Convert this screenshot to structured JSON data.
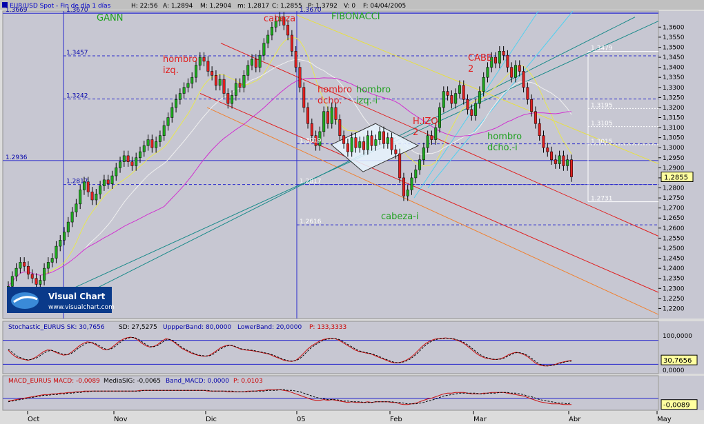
{
  "header": {
    "title": "EUR/USD Spot - Fin de día 1 días",
    "quote_h": "H: 22:56",
    "quote_a": "A: 1,2894",
    "quote_m": "M: 1,2904",
    "quote_m2": "m: 1,2817",
    "quote_c": "C: 1,2855",
    "quote_p": "P: 1,3792",
    "quote_v": "V: 0",
    "quote_f": "F: 04/04/2005"
  },
  "logo": {
    "name": "Visual Chart",
    "url": "www.visualchart.com"
  },
  "colors": {
    "background": "#c7c7d2",
    "up_candle": "#1fa81f",
    "down_candle": "#e02020",
    "fib_line": "#2a2acc",
    "yellow_ma": "#e8e850",
    "white_ma": "#f0f0f0",
    "magenta_ma": "#d030d0",
    "red_channel": "#e02020",
    "orange_channel": "#f08030",
    "teal_channel": "#1a8a8a",
    "cyan_line": "#50d0f0"
  },
  "chart_data": [
    {
      "type": "candlestick",
      "title": "EUR/USD Spot",
      "ylim": [
        1.215,
        1.368
      ],
      "yticks": [
        "1,3600",
        "1,3550",
        "1,3500",
        "1,3450",
        "1,3400",
        "1,3350",
        "1,3300",
        "1,3250",
        "1,3200",
        "1,3150",
        "1,3100",
        "1,3050",
        "1,3000",
        "1,2950",
        "1,2900",
        "1,2850",
        "1,2800",
        "1,2750",
        "1,2700",
        "1,2650",
        "1,2600",
        "1,2550",
        "1,2500",
        "1,2450",
        "1,2400",
        "1,2350",
        "1,2300",
        "1,2250",
        "1,2200"
      ],
      "ytick_values": [
        1.36,
        1.355,
        1.35,
        1.345,
        1.34,
        1.335,
        1.33,
        1.325,
        1.32,
        1.315,
        1.31,
        1.305,
        1.3,
        1.295,
        1.29,
        1.285,
        1.28,
        1.275,
        1.27,
        1.265,
        1.26,
        1.255,
        1.25,
        1.245,
        1.24,
        1.235,
        1.23,
        1.225,
        1.22
      ],
      "last_price": "1,2855",
      "last_value": 1.2855,
      "xticks": [
        "Oct",
        "Nov",
        "Dic",
        "05",
        "Feb",
        "Mar",
        "Abr",
        "May"
      ],
      "levels_left": [
        {
          "value": 1.3669,
          "label": "1.3669"
        },
        {
          "value": 1.2936,
          "label": "1.2936"
        }
      ],
      "levels_gann": [
        {
          "value": 1.367,
          "label": "1.3670"
        },
        {
          "value": 1.3457,
          "label": "1.3457"
        },
        {
          "value": 1.3242,
          "label": "1.3242"
        },
        {
          "value": 1.2817,
          "label": "1.2817"
        }
      ],
      "levels_fib": [
        {
          "value": 1.367,
          "label": "1.3670"
        },
        {
          "value": 1.3019,
          "label": "1.3019"
        },
        {
          "value": 1.2817,
          "label": "1.2817"
        },
        {
          "value": 1.2616,
          "label": "1.2616"
        }
      ],
      "levels_right": [
        {
          "value": 1.3479,
          "label": "1.3479"
        },
        {
          "value": 1.3195,
          "label": "1.3195"
        },
        {
          "value": 1.3105,
          "label": "1.3105"
        },
        {
          "value": 1.3015,
          "label": "1.3015"
        },
        {
          "value": 1.2731,
          "label": "1.2731"
        }
      ],
      "annotations": [
        {
          "text": "GANN",
          "color": "green"
        },
        {
          "text": "FIBONACCI",
          "color": "green"
        },
        {
          "text": "cabeza",
          "color": "red"
        },
        {
          "text": "hombro",
          "color": "red"
        },
        {
          "text": "izq.",
          "color": "red"
        },
        {
          "text": "hombro",
          "color": "red"
        },
        {
          "text": "dcho.",
          "color": "red"
        },
        {
          "text": "hombro",
          "color": "green"
        },
        {
          "text": "izq.-i",
          "color": "green"
        },
        {
          "text": "H.IZQ.",
          "color": "red"
        },
        {
          "text": "2",
          "color": "red"
        },
        {
          "text": "CABE",
          "color": "red"
        },
        {
          "text": "2",
          "color": "red"
        },
        {
          "text": "hombro",
          "color": "green"
        },
        {
          "text": "dcho.-i",
          "color": "green"
        },
        {
          "text": "cabeza-i",
          "color": "green"
        }
      ],
      "close_values": [
        1.231,
        1.236,
        1.24,
        1.243,
        1.241,
        1.237,
        1.235,
        1.232,
        1.234,
        1.24,
        1.243,
        1.245,
        1.251,
        1.254,
        1.258,
        1.263,
        1.268,
        1.272,
        1.279,
        1.283,
        1.278,
        1.274,
        1.277,
        1.281,
        1.284,
        1.282,
        1.286,
        1.29,
        1.293,
        1.296,
        1.293,
        1.291,
        1.295,
        1.298,
        1.301,
        1.304,
        1.3,
        1.303,
        1.306,
        1.311,
        1.315,
        1.32,
        1.324,
        1.327,
        1.33,
        1.332,
        1.335,
        1.341,
        1.345,
        1.343,
        1.338,
        1.336,
        1.331,
        1.334,
        1.327,
        1.322,
        1.326,
        1.332,
        1.33,
        1.336,
        1.341,
        1.344,
        1.34,
        1.346,
        1.352,
        1.356,
        1.36,
        1.363,
        1.365,
        1.361,
        1.356,
        1.348,
        1.34,
        1.33,
        1.32,
        1.312,
        1.306,
        1.301,
        1.308,
        1.318,
        1.312,
        1.32,
        1.314,
        1.306,
        1.302,
        1.298,
        1.305,
        1.3,
        1.303,
        1.299,
        1.306,
        1.301,
        1.304,
        1.308,
        1.302,
        1.305,
        1.299,
        1.297,
        1.285,
        1.276,
        1.279,
        1.285,
        1.289,
        1.294,
        1.3,
        1.306,
        1.304,
        1.31,
        1.32,
        1.328,
        1.326,
        1.322,
        1.327,
        1.331,
        1.324,
        1.319,
        1.316,
        1.322,
        1.328,
        1.335,
        1.34,
        1.345,
        1.342,
        1.348,
        1.346,
        1.34,
        1.335,
        1.341,
        1.338,
        1.33,
        1.324,
        1.318,
        1.312,
        1.306,
        1.3,
        1.298,
        1.294,
        1.292,
        1.296,
        1.291,
        1.294,
        1.2855
      ]
    },
    {
      "type": "line",
      "title": "Stochastic_EURUS",
      "labels": {
        "sk": "Stochastic_EURUS SK: 30,7656",
        "sd": "SD: 27,5275",
        "upper": "UppperBand: 80,0000",
        "lower": "LowerBand: 20,0000",
        "p": "P: 133,3333"
      },
      "ylim": [
        0,
        100
      ],
      "yticks": [
        "100,0000",
        "0,0000"
      ],
      "bands": [
        80,
        20
      ],
      "last_value": "30,7656",
      "series": [
        {
          "name": "SK",
          "values": [
            55,
            45,
            38,
            34,
            32,
            30,
            33,
            38,
            45,
            52,
            56,
            55,
            50,
            46,
            43,
            44,
            50,
            58,
            66,
            72,
            76,
            75,
            70,
            64,
            58,
            56,
            60,
            68,
            76,
            82,
            86,
            88,
            86,
            80,
            72,
            66,
            63,
            65,
            70,
            78,
            84,
            82,
            76,
            68,
            60,
            55,
            50,
            46,
            43,
            41,
            40,
            42,
            48,
            55,
            62,
            66,
            68,
            66,
            62,
            58,
            56,
            55,
            54,
            52,
            50,
            48,
            46,
            42,
            38,
            34,
            30,
            28,
            27,
            30,
            38,
            48,
            58,
            66,
            72,
            78,
            82,
            84,
            85,
            84,
            80,
            74,
            68,
            62,
            56,
            52,
            50,
            48,
            46,
            42,
            38,
            34,
            30,
            26,
            24,
            24,
            26,
            30,
            36,
            44,
            54,
            64,
            72,
            78,
            82,
            84,
            85,
            86,
            85,
            83,
            80,
            76,
            70,
            62,
            54,
            46,
            40,
            36,
            34,
            32,
            32,
            34,
            38,
            44,
            48,
            50,
            48,
            44,
            38,
            30,
            22,
            18,
            16,
            16,
            18,
            20,
            24,
            26,
            28,
            30
          ]
        },
        {
          "name": "SD",
          "values": [
            58,
            50,
            42,
            37,
            33,
            31,
            32,
            35,
            41,
            48,
            53,
            55,
            52,
            48,
            45,
            44,
            47,
            54,
            62,
            68,
            73,
            75,
            72,
            67,
            61,
            57,
            58,
            64,
            72,
            79,
            84,
            87,
            87,
            83,
            76,
            69,
            64,
            64,
            67,
            74,
            81,
            82,
            78,
            71,
            63,
            57,
            52,
            48,
            44,
            42,
            41,
            41,
            45,
            52,
            59,
            64,
            67,
            67,
            63,
            59,
            57,
            56,
            55,
            53,
            51,
            49,
            47,
            44,
            40,
            36,
            32,
            29,
            28,
            29,
            34,
            43,
            53,
            62,
            69,
            75,
            80,
            83,
            84,
            84,
            82,
            77,
            71,
            65,
            59,
            54,
            51,
            49,
            47,
            44,
            40,
            36,
            32,
            28,
            25,
            24,
            25,
            28,
            33,
            40,
            49,
            59,
            68,
            75,
            80,
            83,
            84,
            85,
            85,
            84,
            81,
            78,
            73,
            66,
            58,
            50,
            43,
            38,
            35,
            33,
            32,
            33,
            36,
            41,
            46,
            49,
            49,
            46,
            41,
            34,
            26,
            20,
            17,
            16,
            17,
            19,
            22,
            25,
            27,
            28
          ]
        }
      ]
    },
    {
      "type": "line",
      "title": "MACD_EURUS",
      "labels": {
        "macd": "MACD_EURUS MACD: -0,0089",
        "sig": "MediaSIG: -0,0065",
        "band": "Band_MACD: 0,0000",
        "p": "P: 0,0103"
      },
      "ylim": [
        -0.015,
        0.017
      ],
      "band": 0,
      "last_value": "-0,0089",
      "series": [
        {
          "name": "MACD",
          "values": [
            -0.004,
            -0.003,
            -0.002,
            -0.001,
            0.0,
            0.001,
            0.002,
            0.003,
            0.004,
            0.005,
            0.005,
            0.006,
            0.006,
            0.007,
            0.007,
            0.008,
            0.008,
            0.009,
            0.009,
            0.01,
            0.01,
            0.01,
            0.01,
            0.01,
            0.01,
            0.01,
            0.01,
            0.01,
            0.01,
            0.01,
            0.01,
            0.01,
            0.01,
            0.011,
            0.011,
            0.011,
            0.011,
            0.011,
            0.011,
            0.011,
            0.011,
            0.011,
            0.011,
            0.011,
            0.011,
            0.011,
            0.011,
            0.011,
            0.011,
            0.011,
            0.01,
            0.01,
            0.01,
            0.01,
            0.01,
            0.009,
            0.009,
            0.009,
            0.009,
            0.009,
            0.01,
            0.01,
            0.01,
            0.011,
            0.011,
            0.012,
            0.012,
            0.012,
            0.012,
            0.011,
            0.01,
            0.008,
            0.006,
            0.004,
            0.002,
            0.0,
            -0.002,
            -0.003,
            -0.003,
            -0.002,
            -0.003,
            -0.002,
            -0.003,
            -0.004,
            -0.005,
            -0.006,
            -0.005,
            -0.006,
            -0.006,
            -0.006,
            -0.005,
            -0.006,
            -0.005,
            -0.005,
            -0.005,
            -0.005,
            -0.006,
            -0.006,
            -0.008,
            -0.009,
            -0.009,
            -0.008,
            -0.007,
            -0.005,
            -0.003,
            -0.001,
            0.0,
            0.002,
            0.004,
            0.006,
            0.007,
            0.007,
            0.008,
            0.008,
            0.008,
            0.007,
            0.006,
            0.006,
            0.006,
            0.007,
            0.007,
            0.008,
            0.008,
            0.008,
            0.008,
            0.007,
            0.006,
            0.005,
            0.004,
            0.003,
            0.001,
            -0.001,
            -0.003,
            -0.005,
            -0.006,
            -0.007,
            -0.008,
            -0.008,
            -0.008,
            -0.009,
            -0.009,
            -0.009
          ]
        },
        {
          "name": "SIG",
          "values": [
            -0.005,
            -0.004,
            -0.003,
            -0.002,
            -0.001,
            0.0,
            0.001,
            0.002,
            0.003,
            0.004,
            0.004,
            0.005,
            0.005,
            0.006,
            0.006,
            0.007,
            0.007,
            0.008,
            0.008,
            0.009,
            0.009,
            0.01,
            0.01,
            0.01,
            0.01,
            0.01,
            0.01,
            0.01,
            0.01,
            0.01,
            0.01,
            0.01,
            0.01,
            0.01,
            0.011,
            0.011,
            0.011,
            0.011,
            0.011,
            0.011,
            0.011,
            0.011,
            0.011,
            0.011,
            0.011,
            0.011,
            0.011,
            0.011,
            0.011,
            0.011,
            0.011,
            0.01,
            0.01,
            0.01,
            0.01,
            0.01,
            0.01,
            0.009,
            0.009,
            0.009,
            0.009,
            0.01,
            0.01,
            0.01,
            0.01,
            0.011,
            0.011,
            0.011,
            0.012,
            0.012,
            0.011,
            0.011,
            0.01,
            0.009,
            0.007,
            0.005,
            0.003,
            0.001,
            0.0,
            -0.001,
            -0.002,
            -0.002,
            -0.002,
            -0.003,
            -0.004,
            -0.004,
            -0.005,
            -0.005,
            -0.005,
            -0.006,
            -0.006,
            -0.006,
            -0.005,
            -0.005,
            -0.005,
            -0.005,
            -0.005,
            -0.006,
            -0.006,
            -0.007,
            -0.008,
            -0.008,
            -0.008,
            -0.007,
            -0.006,
            -0.004,
            -0.003,
            -0.001,
            0.001,
            0.003,
            0.004,
            0.005,
            0.006,
            0.007,
            0.007,
            0.007,
            0.007,
            0.007,
            0.006,
            0.006,
            0.007,
            0.007,
            0.007,
            0.008,
            0.008,
            0.008,
            0.007,
            0.007,
            0.006,
            0.005,
            0.003,
            0.002,
            0.0,
            -0.002,
            -0.003,
            -0.004,
            -0.005,
            -0.006,
            -0.007,
            -0.007,
            -0.008,
            -0.0065
          ]
        }
      ]
    }
  ]
}
